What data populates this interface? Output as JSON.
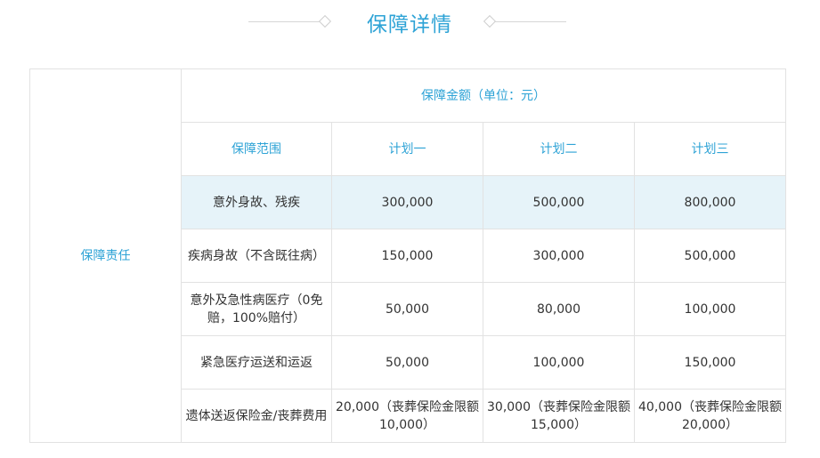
{
  "page_title": "保障详情",
  "table": {
    "row_header": "保障责任",
    "amount_header": "保障金额（单位：元）",
    "scope_header": "保障范围",
    "plans": [
      "计划一",
      "计划二",
      "计划三"
    ],
    "rows": [
      {
        "item": "意外身故、残疾",
        "values": [
          "300,000",
          "500,000",
          "800,000"
        ]
      },
      {
        "item": "疾病身故（不含既往病）",
        "values": [
          "150,000",
          "300,000",
          "500,000"
        ]
      },
      {
        "item": "意外及急性病医疗（0免赔，100%赔付）",
        "values": [
          "50,000",
          "80,000",
          "100,000"
        ]
      },
      {
        "item": "紧急医疗运送和运返",
        "values": [
          "50,000",
          "100,000",
          "150,000"
        ]
      },
      {
        "item": "遗体送返保险金/丧葬费用",
        "values": [
          "20,000（丧葬保险金限额10,000）",
          "30,000（丧葬保险金限额15,000）",
          "40,000（丧葬保险金限额20,000）"
        ]
      }
    ]
  }
}
